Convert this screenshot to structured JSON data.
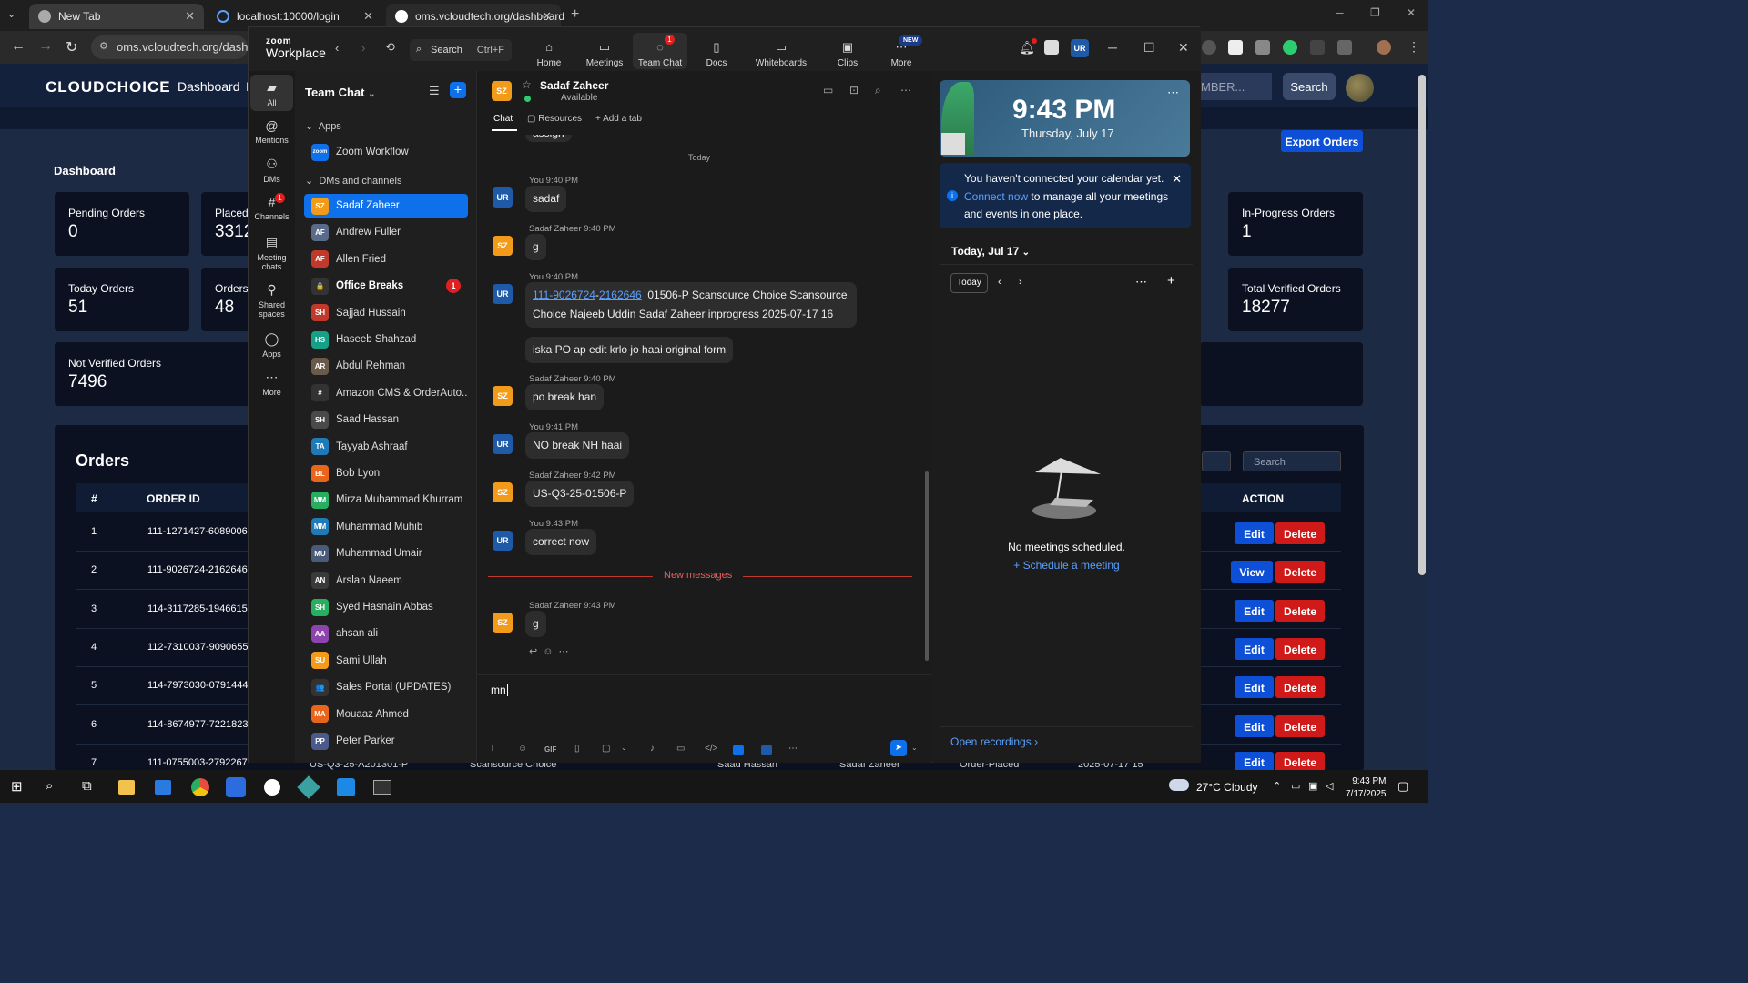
{
  "browser": {
    "tabs": [
      {
        "title": "New Tab"
      },
      {
        "title": "localhost:10000/login"
      },
      {
        "title": "oms.vcloudtech.org/dashboard"
      }
    ],
    "url": "oms.vcloudtech.org/dashboard"
  },
  "oms": {
    "logo": "CLOUDCHOICE",
    "nav": {
      "dashboard": "Dashboard",
      "more": "I"
    },
    "search_placeholder": "MBER...",
    "search_button": "Search",
    "page_title": "Dashboard",
    "export_button": "Export Orders",
    "cards": [
      {
        "label": "Pending Orders",
        "value": "0"
      },
      {
        "label": "Placed O",
        "value": "3312"
      },
      {
        "label": "In-Progress Orders",
        "value": "1"
      },
      {
        "label": "Today Orders",
        "value": "51"
      },
      {
        "label": "Orders P",
        "value": "48"
      },
      {
        "label": "Total Verified Orders",
        "value": "18277"
      },
      {
        "label": "Not Verified Orders",
        "value": "7496"
      }
    ],
    "orders_title": "Orders",
    "filter_search_placeholder": "Search",
    "table_headers": {
      "num": "#",
      "order_id": "ORDER ID",
      "action": "ACTION"
    },
    "rows": [
      {
        "num": "1",
        "id": "111-1271427-6089006",
        "primary": "Edit",
        "secondary": "Delete"
      },
      {
        "num": "2",
        "id": "111-9026724-2162646",
        "primary": "View",
        "secondary": "Delete"
      },
      {
        "num": "3",
        "id": "114-3117285-1946615",
        "primary": "Edit",
        "secondary": "Delete"
      },
      {
        "num": "4",
        "id": "112-7310037-9090655",
        "primary": "Edit",
        "secondary": "Delete"
      },
      {
        "num": "5",
        "id": "114-7973030-0791444",
        "primary": "Edit",
        "secondary": "Delete"
      },
      {
        "num": "6",
        "id": "114-8674977-7221823",
        "primary": "Edit",
        "secondary": "Delete"
      },
      {
        "num": "7",
        "id": "111-0755003-2792267",
        "primary": "Edit",
        "secondary": "Delete"
      }
    ],
    "row7_extra": {
      "po": "US-Q3-25-A201301-P",
      "supplier": "Scansource Choice",
      "user": "Saad Hassan",
      "agent": "Sadaf Zaheer",
      "status": "Order-Placed",
      "date": "2025-07-17 15"
    }
  },
  "zoom": {
    "logo_top": "zoom",
    "logo_bottom": "Workplace",
    "search": {
      "label": "Search",
      "shortcut": "Ctrl+F"
    },
    "nav": [
      {
        "label": "Home",
        "icon": "home-icon"
      },
      {
        "label": "Meetings",
        "icon": "camera-icon"
      },
      {
        "label": "Team Chat",
        "icon": "chat-icon",
        "badge": "1"
      },
      {
        "label": "Docs",
        "icon": "doc-icon"
      },
      {
        "label": "Whiteboards",
        "icon": "whiteboard-icon"
      },
      {
        "label": "Clips",
        "icon": "clips-icon"
      },
      {
        "label": "More",
        "icon": "more-icon"
      }
    ],
    "new_badge": "NEW",
    "user_initials": "UR",
    "rail": [
      {
        "label": "All"
      },
      {
        "label": "Mentions"
      },
      {
        "label": "DMs"
      },
      {
        "label": "Channels",
        "badge": "1"
      },
      {
        "label": "Meeting chats"
      },
      {
        "label": "Shared spaces"
      },
      {
        "label": "Apps"
      },
      {
        "label": "More"
      }
    ],
    "list_title": "Team Chat",
    "section_apps": "Apps",
    "section_dms": "DMs and channels",
    "contacts": [
      {
        "name": "Zoom Workflow",
        "initials": "zoom",
        "color": "#0e71eb"
      },
      {
        "name": "Sadaf Zaheer",
        "initials": "SZ",
        "color": "#f29b1b"
      },
      {
        "name": "Andrew Fuller",
        "initials": "AF",
        "color": "#5a6a8a"
      },
      {
        "name": "Allen Fried",
        "initials": "AF",
        "color": "#c0392b"
      },
      {
        "name": "Office Breaks",
        "initials": "🔒",
        "color": "#333333",
        "badge": "1"
      },
      {
        "name": "Sajjad Hussain",
        "initials": "SH",
        "color": "#c0392b"
      },
      {
        "name": "Haseeb Shahzad",
        "initials": "HS",
        "color": "#16a085"
      },
      {
        "name": "Abdul Rehman",
        "initials": "AR",
        "color": "#6a5a4a"
      },
      {
        "name": "Amazon CMS & OrderAuto...",
        "initials": "#",
        "color": "#333333"
      },
      {
        "name": "Saad Hassan",
        "initials": "SH",
        "color": "#4a4a4a"
      },
      {
        "name": "Tayyab Ashraaf",
        "initials": "TA",
        "color": "#1f7ab8"
      },
      {
        "name": "Bob Lyon",
        "initials": "BL",
        "color": "#e8651b"
      },
      {
        "name": "Mirza Muhammad Khurram",
        "initials": "MM",
        "color": "#27ae60"
      },
      {
        "name": "Muhammad Muhib",
        "initials": "MM",
        "color": "#1f7ab8"
      },
      {
        "name": "Muhammad Umair",
        "initials": "MU",
        "color": "#4a5a7a"
      },
      {
        "name": "Arslan Naeem",
        "initials": "AN",
        "color": "#3a3a3a"
      },
      {
        "name": "Syed Hasnain Abbas",
        "initials": "SH",
        "color": "#27ae60"
      },
      {
        "name": "ahsan ali",
        "initials": "AA",
        "color": "#8e44ad"
      },
      {
        "name": "Sami Ullah",
        "initials": "SU",
        "color": "#f29b1b"
      },
      {
        "name": "Sales Portal (UPDATES)",
        "initials": "👥",
        "color": "#333333"
      },
      {
        "name": "Mouaaz Ahmed",
        "initials": "MA",
        "color": "#e8651b"
      },
      {
        "name": "Peter Parker",
        "initials": "PP",
        "color": "#4a5a8a"
      }
    ],
    "conversation": {
      "name": "Sadaf Zaheer",
      "initials": "SZ",
      "status": "Available",
      "tabs": {
        "chat": "Chat",
        "resources": "Resources",
        "add": "Add a tab"
      },
      "partial_top": "assign",
      "today": "Today",
      "messages": [
        {
          "meta": "You 9:40 PM",
          "text": "sadaf"
        },
        {
          "meta": "Sadaf Zaheer 9:40 PM",
          "text": "g"
        },
        {
          "meta": "You 9:40 PM",
          "link1": "111-9026724",
          "link2": "2162646",
          "text_line1": "01506-P  Scansource Choice Scansource",
          "text_line2": "Choice  Najeeb Uddin  Sadaf Zaheer  inprogress  2025-07-17 16",
          "followup": "iska PO ap edit krlo jo haai original form"
        },
        {
          "meta": "Sadaf Zaheer 9:40 PM",
          "text": "po break han"
        },
        {
          "meta": "You 9:41 PM",
          "text": "NO break NH haai"
        },
        {
          "meta": "Sadaf Zaheer 9:42 PM",
          "text": "US-Q3-25-01506-P"
        },
        {
          "meta": "You 9:43 PM",
          "text": "correct now"
        },
        {
          "meta": "Sadaf Zaheer 9:43 PM",
          "text": "g"
        }
      ],
      "new_messages": "New messages",
      "composer_text": "mn"
    },
    "calendar": {
      "time": "9:43 PM",
      "date": "Thursday, July 17",
      "connect_text_1": "You haven't connected your calendar yet.",
      "connect_link": "Connect now",
      "connect_text_2": "to manage all your meetings and events in one place.",
      "today_header": "Today, Jul 17",
      "today_button": "Today",
      "no_meetings": "No meetings scheduled.",
      "schedule": "Schedule a meeting",
      "open_recordings": "Open recordings"
    }
  },
  "taskbar": {
    "weather": "27°C  Cloudy",
    "time": "9:43 PM",
    "date": "7/17/2025"
  }
}
